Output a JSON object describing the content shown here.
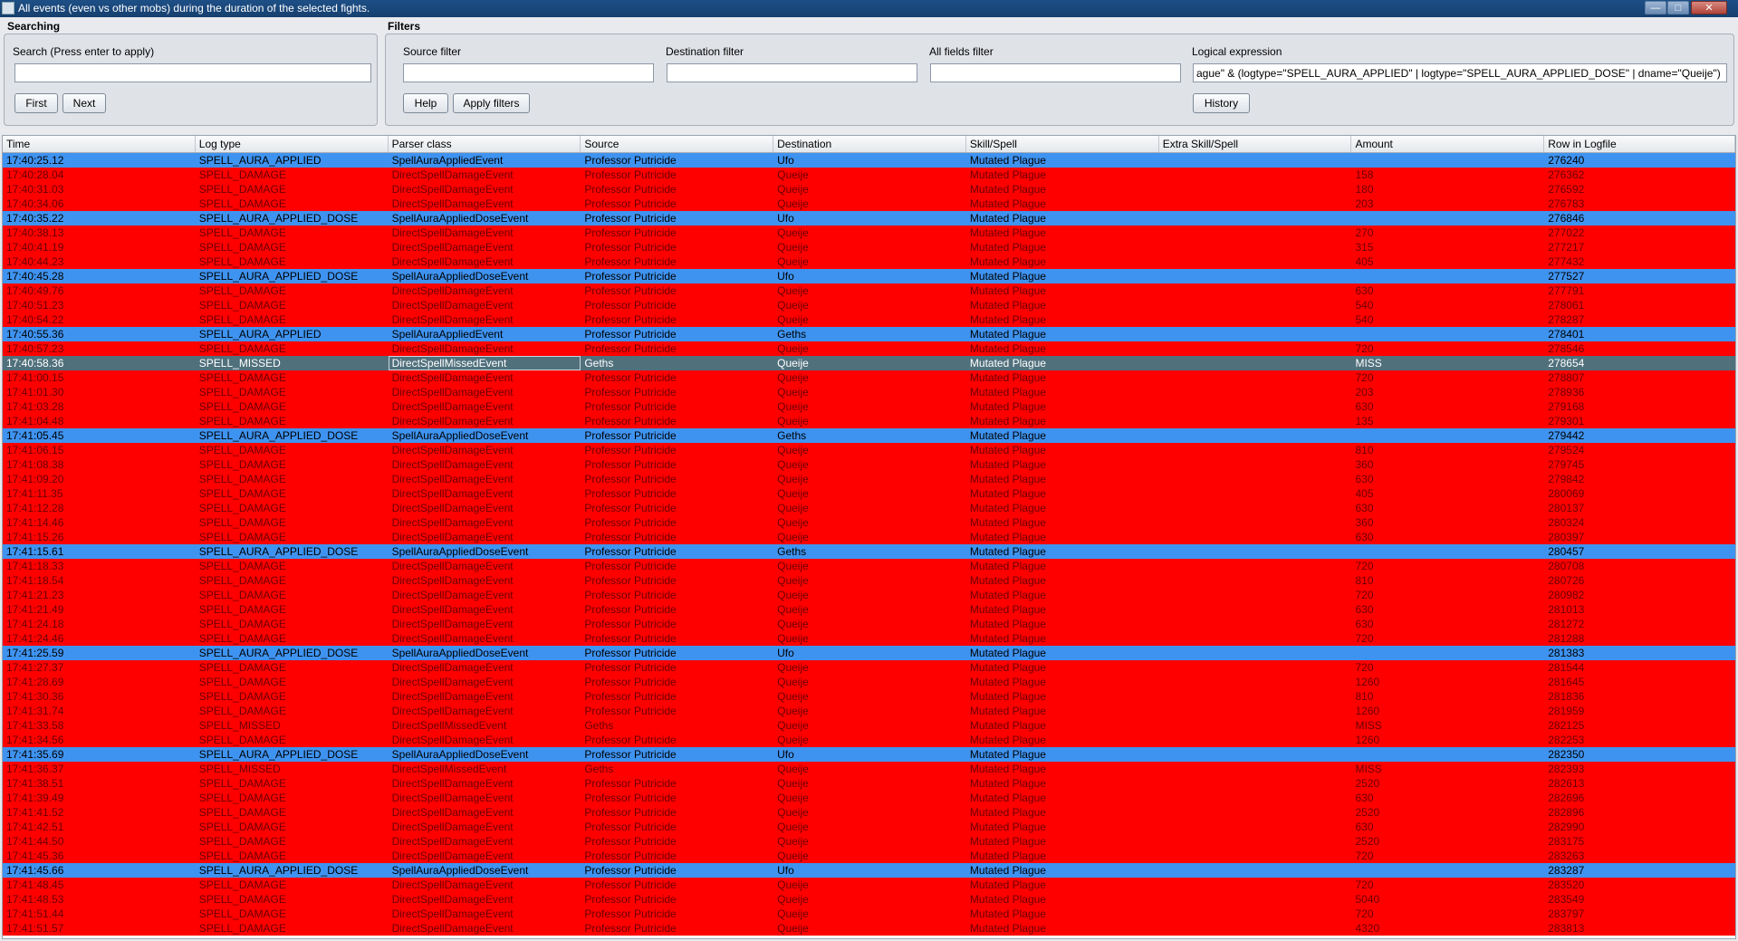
{
  "window": {
    "title": "All events (even vs other mobs) during the duration of the selected fights.",
    "minimize": "—",
    "maximize": "□",
    "close": "✕"
  },
  "searching": {
    "section_title": "Searching",
    "search_label": "Search (Press enter to apply)",
    "search_value": "",
    "first_label": "First",
    "next_label": "Next"
  },
  "filters": {
    "section_title": "Filters",
    "source_label": "Source filter",
    "source_value": "",
    "destination_label": "Destination filter",
    "destination_value": "",
    "allfields_label": "All fields filter",
    "allfields_value": "",
    "logical_label": "Logical expression",
    "logical_value": "ague\" & (logtype=\"SPELL_AURA_APPLIED\" | logtype=\"SPELL_AURA_APPLIED_DOSE\" | dname=\"Queije\")",
    "help_label": "Help",
    "apply_label": "Apply filters",
    "history_label": "History"
  },
  "colors": {
    "applied_row": "#3f93f0",
    "damage_row": "#ff0000",
    "selected_row": "#50707c"
  },
  "table": {
    "columns": [
      "Time",
      "Log type",
      "Parser class",
      "Source",
      "Destination",
      "Skill/Spell",
      "Extra Skill/Spell",
      "Amount",
      "Row in Logfile"
    ],
    "selected_index": 14,
    "rows": [
      [
        "17:40:25.12",
        "SPELL_AURA_APPLIED",
        "SpellAuraAppliedEvent",
        "Professor Putricide",
        "Ufo",
        "Mutated Plague",
        "",
        "",
        "276240"
      ],
      [
        "17:40:28.04",
        "SPELL_DAMAGE",
        "DirectSpellDamageEvent",
        "Professor Putricide",
        "Queije",
        "Mutated Plague",
        "",
        "158",
        "276362"
      ],
      [
        "17:40:31.03",
        "SPELL_DAMAGE",
        "DirectSpellDamageEvent",
        "Professor Putricide",
        "Queije",
        "Mutated Plague",
        "",
        "180",
        "276592"
      ],
      [
        "17:40:34.06",
        "SPELL_DAMAGE",
        "DirectSpellDamageEvent",
        "Professor Putricide",
        "Queije",
        "Mutated Plague",
        "",
        "203",
        "276783"
      ],
      [
        "17:40:35.22",
        "SPELL_AURA_APPLIED_DOSE",
        "SpellAuraAppliedDoseEvent",
        "Professor Putricide",
        "Ufo",
        "Mutated Plague",
        "",
        "",
        "276846"
      ],
      [
        "17:40:38.13",
        "SPELL_DAMAGE",
        "DirectSpellDamageEvent",
        "Professor Putricide",
        "Queije",
        "Mutated Plague",
        "",
        "270",
        "277022"
      ],
      [
        "17:40:41.19",
        "SPELL_DAMAGE",
        "DirectSpellDamageEvent",
        "Professor Putricide",
        "Queije",
        "Mutated Plague",
        "",
        "315",
        "277217"
      ],
      [
        "17:40:44.23",
        "SPELL_DAMAGE",
        "DirectSpellDamageEvent",
        "Professor Putricide",
        "Queije",
        "Mutated Plague",
        "",
        "405",
        "277432"
      ],
      [
        "17:40:45.28",
        "SPELL_AURA_APPLIED_DOSE",
        "SpellAuraAppliedDoseEvent",
        "Professor Putricide",
        "Ufo",
        "Mutated Plague",
        "",
        "",
        "277527"
      ],
      [
        "17:40:49.76",
        "SPELL_DAMAGE",
        "DirectSpellDamageEvent",
        "Professor Putricide",
        "Queije",
        "Mutated Plague",
        "",
        "630",
        "277791"
      ],
      [
        "17:40:51.23",
        "SPELL_DAMAGE",
        "DirectSpellDamageEvent",
        "Professor Putricide",
        "Queije",
        "Mutated Plague",
        "",
        "540",
        "278061"
      ],
      [
        "17:40:54.22",
        "SPELL_DAMAGE",
        "DirectSpellDamageEvent",
        "Professor Putricide",
        "Queije",
        "Mutated Plague",
        "",
        "540",
        "278287"
      ],
      [
        "17:40:55.36",
        "SPELL_AURA_APPLIED",
        "SpellAuraAppliedEvent",
        "Professor Putricide",
        "Geths",
        "Mutated Plague",
        "",
        "",
        "278401"
      ],
      [
        "17:40:57.23",
        "SPELL_DAMAGE",
        "DirectSpellDamageEvent",
        "Professor Putricide",
        "Queije",
        "Mutated Plague",
        "",
        "720",
        "278546"
      ],
      [
        "17:40:58.36",
        "SPELL_MISSED",
        "DirectSpellMissedEvent",
        "Geths",
        "Queije",
        "Mutated Plague",
        "",
        "MISS",
        "278654"
      ],
      [
        "17:41:00.15",
        "SPELL_DAMAGE",
        "DirectSpellDamageEvent",
        "Professor Putricide",
        "Queije",
        "Mutated Plague",
        "",
        "720",
        "278807"
      ],
      [
        "17:41:01.30",
        "SPELL_DAMAGE",
        "DirectSpellDamageEvent",
        "Professor Putricide",
        "Queije",
        "Mutated Plague",
        "",
        "203",
        "278936"
      ],
      [
        "17:41:03.28",
        "SPELL_DAMAGE",
        "DirectSpellDamageEvent",
        "Professor Putricide",
        "Queije",
        "Mutated Plague",
        "",
        "630",
        "279168"
      ],
      [
        "17:41:04.48",
        "SPELL_DAMAGE",
        "DirectSpellDamageEvent",
        "Professor Putricide",
        "Queije",
        "Mutated Plague",
        "",
        "135",
        "279301"
      ],
      [
        "17:41:05.45",
        "SPELL_AURA_APPLIED_DOSE",
        "SpellAuraAppliedDoseEvent",
        "Professor Putricide",
        "Geths",
        "Mutated Plague",
        "",
        "",
        "279442"
      ],
      [
        "17:41:06.15",
        "SPELL_DAMAGE",
        "DirectSpellDamageEvent",
        "Professor Putricide",
        "Queije",
        "Mutated Plague",
        "",
        "810",
        "279524"
      ],
      [
        "17:41:08.38",
        "SPELL_DAMAGE",
        "DirectSpellDamageEvent",
        "Professor Putricide",
        "Queije",
        "Mutated Plague",
        "",
        "360",
        "279745"
      ],
      [
        "17:41:09.20",
        "SPELL_DAMAGE",
        "DirectSpellDamageEvent",
        "Professor Putricide",
        "Queije",
        "Mutated Plague",
        "",
        "630",
        "279842"
      ],
      [
        "17:41:11.35",
        "SPELL_DAMAGE",
        "DirectSpellDamageEvent",
        "Professor Putricide",
        "Queije",
        "Mutated Plague",
        "",
        "405",
        "280069"
      ],
      [
        "17:41:12.28",
        "SPELL_DAMAGE",
        "DirectSpellDamageEvent",
        "Professor Putricide",
        "Queije",
        "Mutated Plague",
        "",
        "630",
        "280137"
      ],
      [
        "17:41:14.46",
        "SPELL_DAMAGE",
        "DirectSpellDamageEvent",
        "Professor Putricide",
        "Queije",
        "Mutated Plague",
        "",
        "360",
        "280324"
      ],
      [
        "17:41:15.26",
        "SPELL_DAMAGE",
        "DirectSpellDamageEvent",
        "Professor Putricide",
        "Queije",
        "Mutated Plague",
        "",
        "630",
        "280397"
      ],
      [
        "17:41:15.61",
        "SPELL_AURA_APPLIED_DOSE",
        "SpellAuraAppliedDoseEvent",
        "Professor Putricide",
        "Geths",
        "Mutated Plague",
        "",
        "",
        "280457"
      ],
      [
        "17:41:18.33",
        "SPELL_DAMAGE",
        "DirectSpellDamageEvent",
        "Professor Putricide",
        "Queije",
        "Mutated Plague",
        "",
        "720",
        "280708"
      ],
      [
        "17:41:18.54",
        "SPELL_DAMAGE",
        "DirectSpellDamageEvent",
        "Professor Putricide",
        "Queije",
        "Mutated Plague",
        "",
        "810",
        "280726"
      ],
      [
        "17:41:21.23",
        "SPELL_DAMAGE",
        "DirectSpellDamageEvent",
        "Professor Putricide",
        "Queije",
        "Mutated Plague",
        "",
        "720",
        "280982"
      ],
      [
        "17:41:21.49",
        "SPELL_DAMAGE",
        "DirectSpellDamageEvent",
        "Professor Putricide",
        "Queije",
        "Mutated Plague",
        "",
        "630",
        "281013"
      ],
      [
        "17:41:24.18",
        "SPELL_DAMAGE",
        "DirectSpellDamageEvent",
        "Professor Putricide",
        "Queije",
        "Mutated Plague",
        "",
        "630",
        "281272"
      ],
      [
        "17:41:24.46",
        "SPELL_DAMAGE",
        "DirectSpellDamageEvent",
        "Professor Putricide",
        "Queije",
        "Mutated Plague",
        "",
        "720",
        "281288"
      ],
      [
        "17:41:25.59",
        "SPELL_AURA_APPLIED_DOSE",
        "SpellAuraAppliedDoseEvent",
        "Professor Putricide",
        "Ufo",
        "Mutated Plague",
        "",
        "",
        "281383"
      ],
      [
        "17:41:27.37",
        "SPELL_DAMAGE",
        "DirectSpellDamageEvent",
        "Professor Putricide",
        "Queije",
        "Mutated Plague",
        "",
        "720",
        "281544"
      ],
      [
        "17:41:28.69",
        "SPELL_DAMAGE",
        "DirectSpellDamageEvent",
        "Professor Putricide",
        "Queije",
        "Mutated Plague",
        "",
        "1260",
        "281645"
      ],
      [
        "17:41:30.36",
        "SPELL_DAMAGE",
        "DirectSpellDamageEvent",
        "Professor Putricide",
        "Queije",
        "Mutated Plague",
        "",
        "810",
        "281836"
      ],
      [
        "17:41:31.74",
        "SPELL_DAMAGE",
        "DirectSpellDamageEvent",
        "Professor Putricide",
        "Queije",
        "Mutated Plague",
        "",
        "1260",
        "281959"
      ],
      [
        "17:41:33.58",
        "SPELL_MISSED",
        "DirectSpellMissedEvent",
        "Geths",
        "Queije",
        "Mutated Plague",
        "",
        "MISS",
        "282125"
      ],
      [
        "17:41:34.56",
        "SPELL_DAMAGE",
        "DirectSpellDamageEvent",
        "Professor Putricide",
        "Queije",
        "Mutated Plague",
        "",
        "1260",
        "282253"
      ],
      [
        "17:41:35.69",
        "SPELL_AURA_APPLIED_DOSE",
        "SpellAuraAppliedDoseEvent",
        "Professor Putricide",
        "Ufo",
        "Mutated Plague",
        "",
        "",
        "282350"
      ],
      [
        "17:41:36.37",
        "SPELL_MISSED",
        "DirectSpellMissedEvent",
        "Geths",
        "Queije",
        "Mutated Plague",
        "",
        "MISS",
        "282393"
      ],
      [
        "17:41:38.51",
        "SPELL_DAMAGE",
        "DirectSpellDamageEvent",
        "Professor Putricide",
        "Queije",
        "Mutated Plague",
        "",
        "2520",
        "282613"
      ],
      [
        "17:41:39.49",
        "SPELL_DAMAGE",
        "DirectSpellDamageEvent",
        "Professor Putricide",
        "Queije",
        "Mutated Plague",
        "",
        "630",
        "282696"
      ],
      [
        "17:41:41.52",
        "SPELL_DAMAGE",
        "DirectSpellDamageEvent",
        "Professor Putricide",
        "Queije",
        "Mutated Plague",
        "",
        "2520",
        "282896"
      ],
      [
        "17:41:42.51",
        "SPELL_DAMAGE",
        "DirectSpellDamageEvent",
        "Professor Putricide",
        "Queije",
        "Mutated Plague",
        "",
        "630",
        "282990"
      ],
      [
        "17:41:44.50",
        "SPELL_DAMAGE",
        "DirectSpellDamageEvent",
        "Professor Putricide",
        "Queije",
        "Mutated Plague",
        "",
        "2520",
        "283175"
      ],
      [
        "17:41:45.36",
        "SPELL_DAMAGE",
        "DirectSpellDamageEvent",
        "Professor Putricide",
        "Queije",
        "Mutated Plague",
        "",
        "720",
        "283263"
      ],
      [
        "17:41:45.66",
        "SPELL_AURA_APPLIED_DOSE",
        "SpellAuraAppliedDoseEvent",
        "Professor Putricide",
        "Ufo",
        "Mutated Plague",
        "",
        "",
        "283287"
      ],
      [
        "17:41:48.45",
        "SPELL_DAMAGE",
        "DirectSpellDamageEvent",
        "Professor Putricide",
        "Queije",
        "Mutated Plague",
        "",
        "720",
        "283520"
      ],
      [
        "17:41:48.53",
        "SPELL_DAMAGE",
        "DirectSpellDamageEvent",
        "Professor Putricide",
        "Queije",
        "Mutated Plague",
        "",
        "5040",
        "283549"
      ],
      [
        "17:41:51.44",
        "SPELL_DAMAGE",
        "DirectSpellDamageEvent",
        "Professor Putricide",
        "Queije",
        "Mutated Plague",
        "",
        "720",
        "283797"
      ],
      [
        "17:41:51.57",
        "SPELL_DAMAGE",
        "DirectSpellDamageEvent",
        "Professor Putricide",
        "Queije",
        "Mutated Plague",
        "",
        "4320",
        "283813"
      ]
    ]
  }
}
